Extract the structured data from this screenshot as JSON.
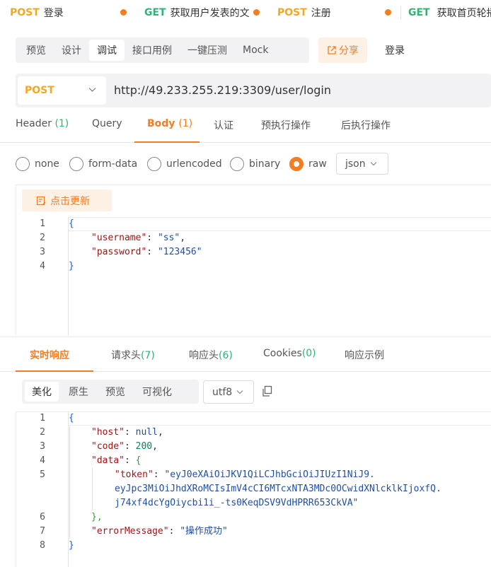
{
  "tabs": [
    {
      "method": "POST",
      "name": "登录",
      "dirty": true
    },
    {
      "method": "GET",
      "name": "获取用户发表的文",
      "dirty": true
    },
    {
      "method": "POST",
      "name": "注册",
      "dirty": true
    },
    {
      "method": "GET",
      "name": "获取首页轮播",
      "dirty": false
    }
  ],
  "modebar": {
    "items": [
      "预览",
      "设计",
      "调试",
      "接口用例",
      "一键压测",
      "Mock"
    ],
    "active": "调试"
  },
  "share_label": "分享",
  "api_name": "登录",
  "request": {
    "method": "POST",
    "url": "http://49.233.255.219:3309/user/login"
  },
  "param_tabs": [
    {
      "label": "Header",
      "count": "(1)"
    },
    {
      "label": "Query",
      "count": ""
    },
    {
      "label": "Body",
      "count": "(1)",
      "active": true
    },
    {
      "label": "认证",
      "count": ""
    },
    {
      "label": "预执行操作",
      "count": ""
    },
    {
      "label": "后执行操作",
      "count": ""
    }
  ],
  "body_types": [
    "none",
    "form-data",
    "urlencoded",
    "binary",
    "raw"
  ],
  "body_type_selected": "raw",
  "body_format": "json",
  "update_label": "点击更新",
  "request_body": {
    "line_numbers": [
      "1",
      "2",
      "3",
      "4"
    ],
    "open": "{",
    "close": "}",
    "username_key": "\"username\"",
    "username_val": "\"ss\"",
    "password_key": "\"password\"",
    "password_val": "\"123456\""
  },
  "response_tabs": [
    {
      "label": "实时响应",
      "count": "",
      "active": true
    },
    {
      "label": "请求头",
      "count": "(7)"
    },
    {
      "label": "响应头",
      "count": "(6)"
    },
    {
      "label": "Cookies",
      "count": "(0)"
    },
    {
      "label": "响应示例",
      "count": ""
    }
  ],
  "format_tabs": [
    "美化",
    "原生",
    "预览",
    "可视化"
  ],
  "format_active": "美化",
  "encoding": "utf8",
  "response_body": {
    "line_numbers": [
      "1",
      "2",
      "3",
      "4",
      "5",
      "6",
      "7",
      "8"
    ],
    "open": "{",
    "close": "}",
    "host_key": "\"host\"",
    "host_val": "null",
    "code_key": "\"code\"",
    "code_val": "200",
    "data_key": "\"data\"",
    "data_open": "{",
    "data_close": "},",
    "token_key": "\"token\"",
    "token_line1": "\"eyJ0eXAiOiJKV1QiLCJhbGciOiJIUzI1NiJ9.",
    "token_line2": "eyJpc3MiOiJhdXRoMCIsImV4cCI6MTcxNTA3MDc0OCwidXNlcklkIjoxfQ.",
    "token_line3": "j74xf4dcYgOiycbi1i_-ts0KeqDSV9VdHPRR653CkVA\"",
    "err_key": "\"errorMessage\"",
    "err_val": "\"操作成功\""
  },
  "colors": {
    "accent": "#f57c1f",
    "post": "#f5a623",
    "get": "#2bb673"
  }
}
